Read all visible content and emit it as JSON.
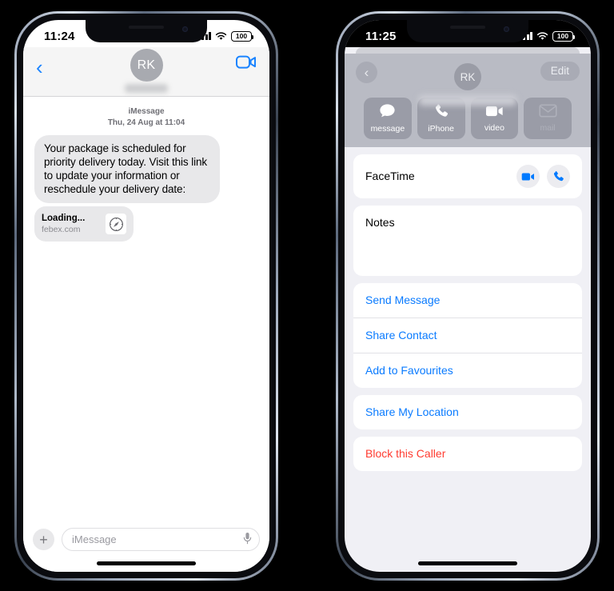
{
  "left_phone": {
    "status_bar": {
      "time": "11:24",
      "battery": "100",
      "signal_icon": "cellular-bars-icon",
      "wifi_icon": "wifi-icon",
      "battery_icon": "battery-icon"
    },
    "header": {
      "back_icon": "back-chevron-icon",
      "avatar_initials": "RK",
      "contact_name_redacted": "",
      "facetime_icon": "video-camera-icon"
    },
    "thread": {
      "service_label": "iMessage",
      "timestamp": "Thu, 24 Aug at 11:04",
      "message_text": "Your package is scheduled for priority delivery today. Visit this link to update your information or reschedule your delivery date:",
      "link_preview": {
        "title": "Loading...",
        "host": "febex.com",
        "icon": "safari-compass-icon"
      }
    },
    "composer": {
      "plus_icon": "plus-icon",
      "placeholder": "iMessage",
      "mic_icon": "microphone-icon"
    }
  },
  "right_phone": {
    "status_bar": {
      "time": "11:25",
      "battery": "100",
      "signal_icon": "cellular-bars-icon",
      "wifi_icon": "wifi-icon",
      "battery_icon": "battery-icon"
    },
    "hero": {
      "back_icon": "back-chevron-icon",
      "edit_label": "Edit",
      "avatar_initials": "RK",
      "contact_name_redacted": ""
    },
    "actions": [
      {
        "label": "message",
        "icon": "message-bubble-icon",
        "disabled": false
      },
      {
        "label": "iPhone",
        "icon": "phone-handset-icon",
        "disabled": false
      },
      {
        "label": "video",
        "icon": "video-camera-icon",
        "disabled": false
      },
      {
        "label": "mail",
        "icon": "envelope-icon",
        "disabled": true
      }
    ],
    "facetime": {
      "label": "FaceTime",
      "video_icon": "video-camera-icon",
      "audio_icon": "phone-handset-icon"
    },
    "notes": {
      "label": "Notes"
    },
    "list_group_1": [
      {
        "label": "Send Message",
        "style": "link"
      },
      {
        "label": "Share Contact",
        "style": "link"
      },
      {
        "label": "Add to Favourites",
        "style": "link"
      }
    ],
    "list_group_2": [
      {
        "label": "Share My Location",
        "style": "link"
      }
    ],
    "list_group_3": [
      {
        "label": "Block this Caller",
        "style": "danger"
      }
    ]
  },
  "colors": {
    "ios_blue": "#007AFF",
    "link_blue": "#0A7BFF",
    "danger_red": "#FF3B30",
    "bubble_grey": "#E8E8EA",
    "page_bg": "#F0F0F5"
  }
}
